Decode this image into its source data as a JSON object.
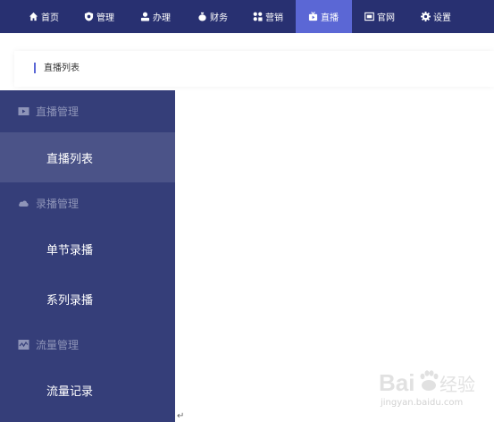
{
  "topnav": {
    "items": [
      {
        "label": "首页",
        "icon": "home-icon"
      },
      {
        "label": "管理",
        "icon": "shield-icon"
      },
      {
        "label": "办理",
        "icon": "user-icon"
      },
      {
        "label": "财务",
        "icon": "money-bag-icon"
      },
      {
        "label": "营销",
        "icon": "marketing-icon"
      },
      {
        "label": "直播",
        "icon": "live-icon",
        "active": true
      },
      {
        "label": "官网",
        "icon": "website-icon"
      },
      {
        "label": "设置",
        "icon": "gear-icon"
      }
    ],
    "colors": {
      "background": "#283071",
      "active": "#5b67d5"
    }
  },
  "content": {
    "card_title": "直播列表"
  },
  "sidebar": {
    "groups": [
      {
        "label": "直播管理",
        "icon": "video-icon",
        "items": [
          {
            "label": "直播列表",
            "active": true
          }
        ]
      },
      {
        "label": "录播管理",
        "icon": "cloud-icon",
        "items": [
          {
            "label": "单节录播"
          },
          {
            "label": "系列录播"
          }
        ]
      },
      {
        "label": "流量管理",
        "icon": "traffic-icon",
        "items": [
          {
            "label": "流量记录"
          }
        ]
      }
    ],
    "colors": {
      "background": "#353e79",
      "active": "#4b5388"
    }
  },
  "return_mark": "↵",
  "watermark": {
    "logo": "Baidu经验",
    "url": "jingyan.baidu.com"
  }
}
